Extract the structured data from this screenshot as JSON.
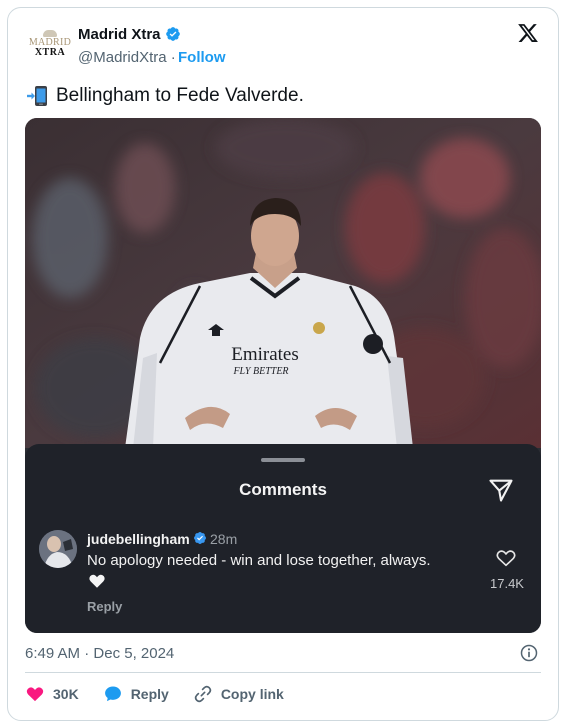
{
  "author": {
    "avatar_line1": "MADRID",
    "avatar_line2": "XTRA",
    "name": "Madrid Xtra",
    "handle": "@MadridXtra",
    "separator": " · ",
    "follow_label": "Follow"
  },
  "tweet": {
    "text": "Bellingham to Fede Valverde.",
    "emoji_icon": "mobile-phone-arrow-icon"
  },
  "media": {
    "jersey_sponsor": "Emirates",
    "jersey_slogan": "FLY BETTER",
    "sheet": {
      "title": "Comments",
      "comment": {
        "username": "judebellingham",
        "time": "28m",
        "text": "No apology needed - win and lose together, always.",
        "emoji_icon": "white-heart-icon",
        "reply_label": "Reply",
        "like_count": "17.4K"
      }
    }
  },
  "meta": {
    "time": "6:49 AM",
    "dot": " · ",
    "date": "Dec 5, 2024"
  },
  "actions": {
    "likes": "30K",
    "reply_label": "Reply",
    "copy_label": "Copy link"
  },
  "colors": {
    "accent": "#1d9bf0",
    "like_red": "#f91880",
    "sheet_bg": "#1f2229"
  }
}
